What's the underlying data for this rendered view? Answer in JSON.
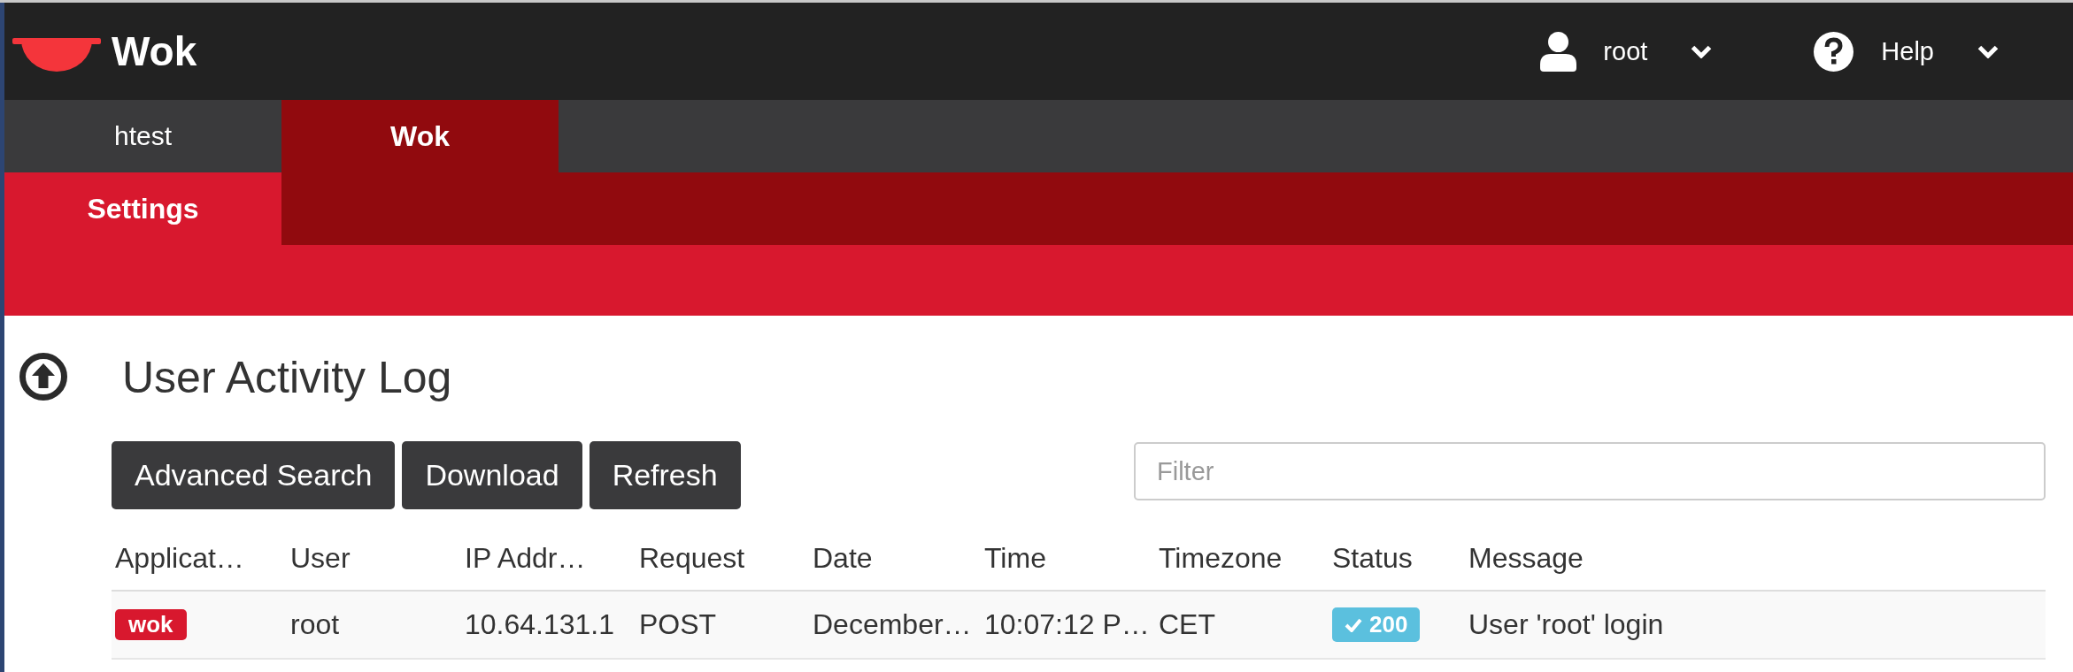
{
  "header": {
    "brand": "Wok",
    "user_menu": "root",
    "help_menu": "Help"
  },
  "tabs": [
    {
      "label": "htest",
      "selected": false
    },
    {
      "label": "Wok",
      "selected": true
    }
  ],
  "subtabs": [
    {
      "label": "Settings",
      "selected": true
    }
  ],
  "page": {
    "title": "User Activity Log",
    "buttons": [
      "Advanced Search",
      "Download",
      "Refresh"
    ],
    "filter": {
      "placeholder": "Filter"
    }
  },
  "table": {
    "columns": [
      "Applicat…",
      "User",
      "IP Addr…",
      "Request",
      "Date",
      "Time",
      "Timezone",
      "Status",
      "Message"
    ],
    "rows": [
      {
        "application": "wok",
        "user": "root",
        "ip_address": "10.64.131.1",
        "request": "POST",
        "date": "December…",
        "time": "10:07:12 P…",
        "timezone": "CET",
        "status": {
          "code": "200",
          "kind": "success"
        },
        "message": "User 'root' login"
      }
    ]
  }
}
